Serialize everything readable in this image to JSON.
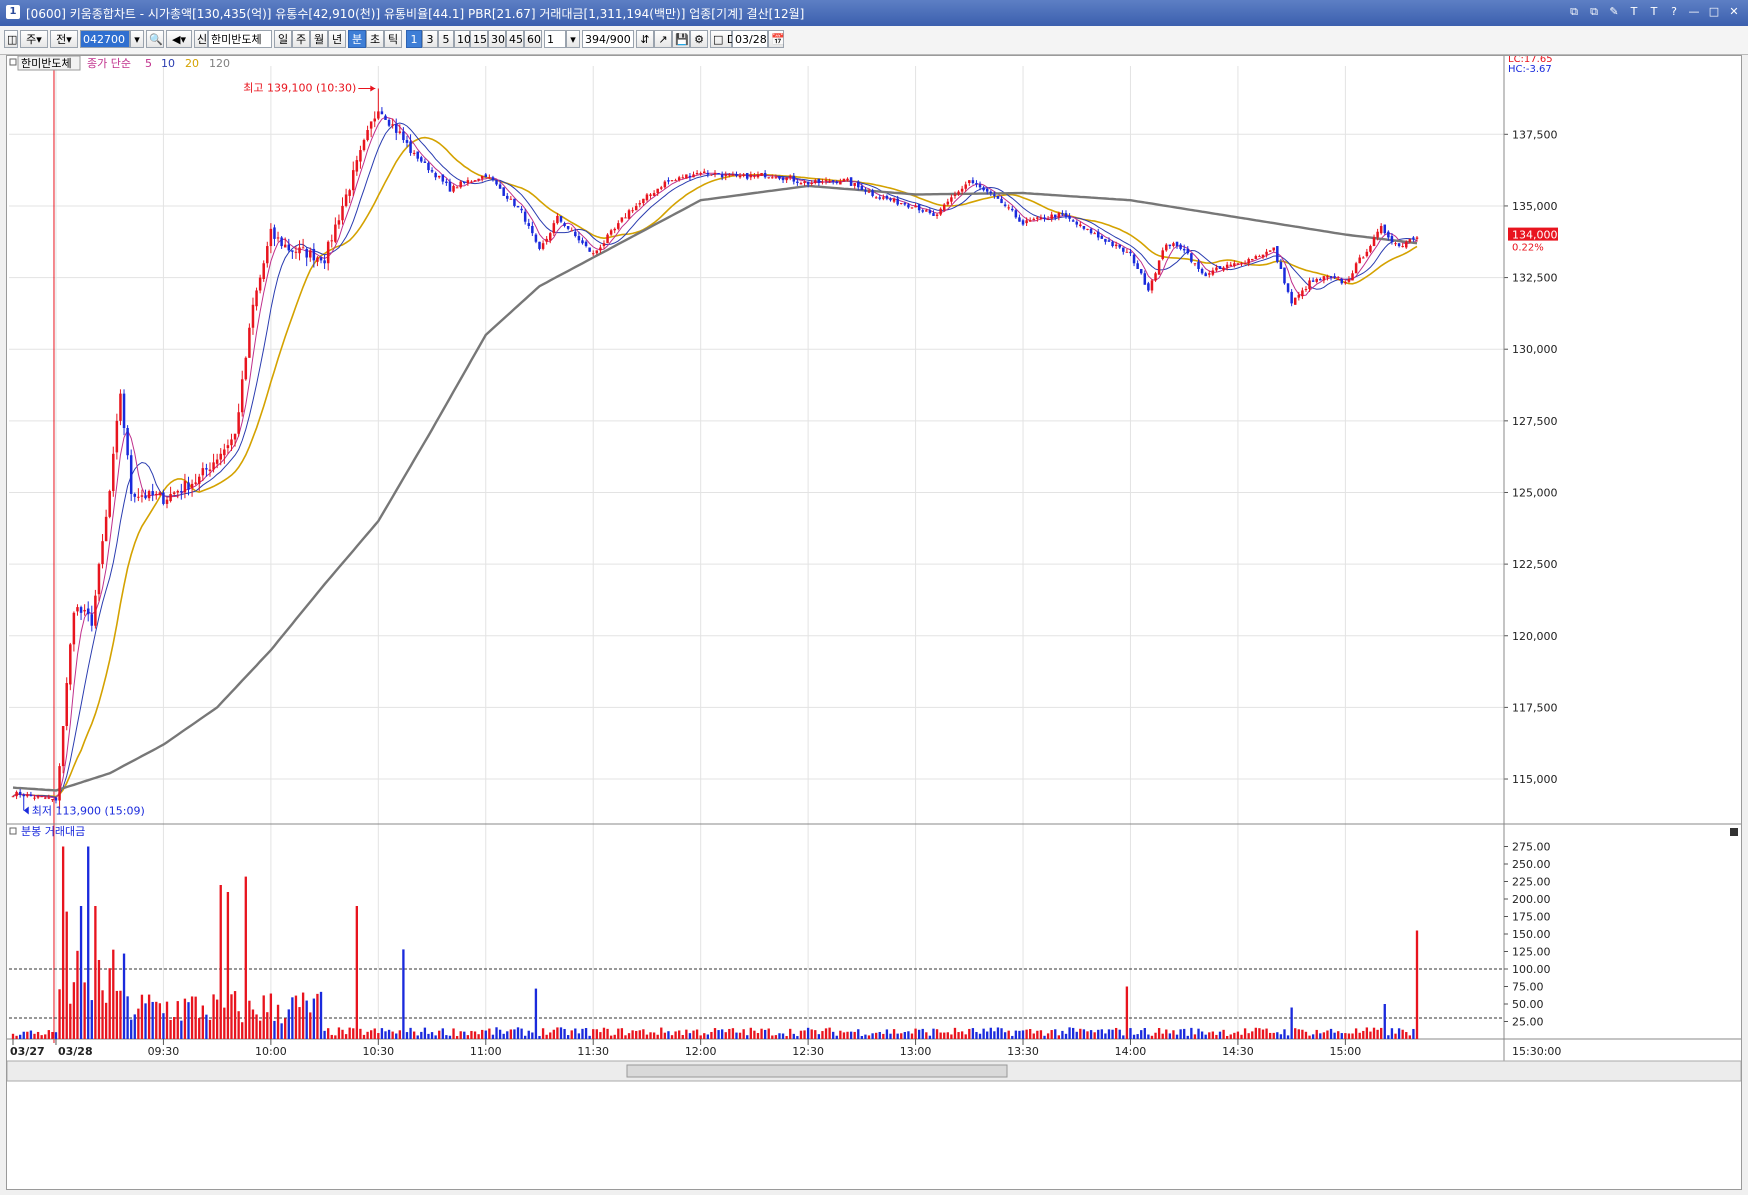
{
  "window": {
    "icon_label": "1",
    "title": "[0600] 키움종합차트 - 시가총액[130,435(억)] 유통수[42,910(천)] 유통비율[44.1] PBR[21.67] 거래대금[1,311,194(백만)] 업종[기계] 결산[12월]",
    "buttons": [
      "⧉",
      "⧉",
      "✎",
      "T",
      "T",
      "?",
      "—",
      "□",
      "✕"
    ]
  },
  "toolbar": {
    "items": [
      {
        "label": "◫",
        "name": "layout-icon"
      },
      {
        "label": "주▾",
        "name": "market-select"
      },
      {
        "label": "전▾",
        "name": "scope-select"
      },
      {
        "label": "042700",
        "name": "stock-code-input",
        "selected": true
      },
      {
        "label": "▾",
        "name": "code-dropdown"
      },
      {
        "label": "🔍",
        "name": "search-icon"
      },
      {
        "label": "◀▾",
        "name": "sound-icon"
      },
      {
        "label": "신",
        "name": "new-button"
      },
      {
        "label": "한미반도체",
        "name": "stock-name-field"
      },
      {
        "label": "일",
        "name": "period-day"
      },
      {
        "label": "주",
        "name": "period-week"
      },
      {
        "label": "월",
        "name": "period-month"
      },
      {
        "label": "년",
        "name": "period-year"
      },
      {
        "label": "분",
        "name": "period-minute",
        "on": true
      },
      {
        "label": "초",
        "name": "period-second"
      },
      {
        "label": "틱",
        "name": "period-tick"
      },
      {
        "label": "1",
        "name": "interval-1",
        "on": true
      },
      {
        "label": "3",
        "name": "interval-3"
      },
      {
        "label": "5",
        "name": "interval-5"
      },
      {
        "label": "10",
        "name": "interval-10"
      },
      {
        "label": "15",
        "name": "interval-15"
      },
      {
        "label": "30",
        "name": "interval-30"
      },
      {
        "label": "45",
        "name": "interval-45"
      },
      {
        "label": "60",
        "name": "interval-60"
      },
      {
        "label": "1",
        "name": "custom-interval-input"
      },
      {
        "label": "▾",
        "name": "custom-interval-dropdown"
      },
      {
        "label": "394/900",
        "name": "data-count-field"
      },
      {
        "label": "⇵",
        "name": "crosshair-icon"
      },
      {
        "label": "↗",
        "name": "trend-tool-icon"
      },
      {
        "label": "💾",
        "name": "save-icon"
      },
      {
        "label": "⚙",
        "name": "settings-icon"
      },
      {
        "label": "□ D",
        "name": "date-checkbox"
      },
      {
        "label": "03/28",
        "name": "date-field"
      },
      {
        "label": "📅",
        "name": "calendar-icon"
      }
    ]
  },
  "price_panel": {
    "stock_tab": "한미반도체",
    "indicator_label": "종가 단순",
    "ma_labels": [
      {
        "text": "5",
        "color": "#c0308c"
      },
      {
        "text": "10",
        "color": "#2a3cb0"
      },
      {
        "text": "20",
        "color": "#d4a200"
      },
      {
        "text": "120",
        "color": "#808080"
      }
    ],
    "lc_label": "LC:17.65",
    "hc_label": "HC:-3.67",
    "high_annotation": "최고 139,100 (10:30)",
    "low_annotation": "최저 113,900 (15:09)",
    "current_price": "134,000",
    "current_change": "0.22%",
    "y_ticks": [
      "137,500",
      "135,000",
      "132,500",
      "130,000",
      "127,500",
      "125,000",
      "122,500",
      "120,000",
      "117,500",
      "115,000"
    ]
  },
  "volume_panel": {
    "label": "분봉 거래대금",
    "y_ticks": [
      "275.00",
      "250.00",
      "225.00",
      "200.00",
      "175.00",
      "150.00",
      "125.00",
      "100.00",
      "75.00",
      "50.00",
      "25.00"
    ]
  },
  "x_axis": {
    "labels": [
      "03/27",
      "03/28",
      "09:30",
      "10:00",
      "10:30",
      "11:00",
      "11:30",
      "12:00",
      "12:30",
      "13:00",
      "13:30",
      "14:00",
      "14:30",
      "15:00"
    ],
    "time_readout": "15:30:00"
  },
  "colors": {
    "up": "#e8141e",
    "down": "#1a2adc",
    "ma5": "#c0308c",
    "ma10": "#2a3cb0",
    "ma20": "#d4a200",
    "ma120": "#777777"
  },
  "chart_data": {
    "type": "candlestick",
    "symbol": "한미반도체",
    "interval": "1 minute",
    "ylim": [
      113500,
      139500
    ],
    "price_anchors": [
      {
        "t": "03/27 15:19",
        "close": 114500
      },
      {
        "t": "03/27 15:30",
        "close": 114300
      },
      {
        "t": "09:00",
        "close": 114200
      },
      {
        "t": "09:05",
        "close": 121000
      },
      {
        "t": "09:10",
        "close": 120500
      },
      {
        "t": "09:15",
        "close": 125000
      },
      {
        "t": "09:18",
        "close": 128500
      },
      {
        "t": "09:21",
        "close": 125000
      },
      {
        "t": "09:30",
        "close": 124800
      },
      {
        "t": "09:40",
        "close": 125500
      },
      {
        "t": "09:50",
        "close": 127000
      },
      {
        "t": "09:55",
        "close": 131500
      },
      {
        "t": "10:00",
        "close": 134000
      },
      {
        "t": "10:05",
        "close": 133500
      },
      {
        "t": "10:15",
        "close": 133200
      },
      {
        "t": "10:25",
        "close": 136800
      },
      {
        "t": "10:30",
        "close": 138500
      },
      {
        "t": "10:40",
        "close": 136800
      },
      {
        "t": "10:50",
        "close": 135600
      },
      {
        "t": "11:00",
        "close": 136100
      },
      {
        "t": "11:10",
        "close": 134800
      },
      {
        "t": "11:15",
        "close": 133400
      },
      {
        "t": "11:20",
        "close": 134600
      },
      {
        "t": "11:30",
        "close": 133300
      },
      {
        "t": "11:40",
        "close": 134800
      },
      {
        "t": "11:50",
        "close": 135800
      },
      {
        "t": "12:00",
        "close": 136200
      },
      {
        "t": "12:10",
        "close": 136000
      },
      {
        "t": "12:20",
        "close": 136100
      },
      {
        "t": "12:30",
        "close": 135800
      },
      {
        "t": "12:40",
        "close": 135900
      },
      {
        "t": "12:50",
        "close": 135300
      },
      {
        "t": "13:00",
        "close": 135000
      },
      {
        "t": "13:05",
        "close": 134600
      },
      {
        "t": "13:15",
        "close": 135900
      },
      {
        "t": "13:25",
        "close": 135000
      },
      {
        "t": "13:30",
        "close": 134400
      },
      {
        "t": "13:40",
        "close": 134700
      },
      {
        "t": "13:50",
        "close": 134000
      },
      {
        "t": "14:00",
        "close": 133300
      },
      {
        "t": "14:05",
        "close": 132100
      },
      {
        "t": "14:10",
        "close": 133700
      },
      {
        "t": "14:15",
        "close": 133500
      },
      {
        "t": "14:20",
        "close": 132600
      },
      {
        "t": "14:30",
        "close": 133000
      },
      {
        "t": "14:40",
        "close": 133500
      },
      {
        "t": "14:45",
        "close": 131600
      },
      {
        "t": "14:50",
        "close": 132300
      },
      {
        "t": "14:55",
        "close": 132500
      },
      {
        "t": "15:00",
        "close": 132300
      },
      {
        "t": "15:05",
        "close": 133300
      },
      {
        "t": "15:10",
        "close": 134200
      },
      {
        "t": "15:15",
        "close": 133600
      },
      {
        "t": "15:20",
        "close": 134000
      }
    ],
    "ma120_anchors": [
      {
        "t": "03/27 15:19",
        "value": 114700
      },
      {
        "t": "09:00",
        "value": 114600
      },
      {
        "t": "09:15",
        "value": 115200
      },
      {
        "t": "09:30",
        "value": 116200
      },
      {
        "t": "09:45",
        "value": 117500
      },
      {
        "t": "10:00",
        "value": 119500
      },
      {
        "t": "10:15",
        "value": 121800
      },
      {
        "t": "10:30",
        "value": 124000
      },
      {
        "t": "10:45",
        "value": 127200
      },
      {
        "t": "11:00",
        "value": 130500
      },
      {
        "t": "11:15",
        "value": 132200
      },
      {
        "t": "11:30",
        "value": 133200
      },
      {
        "t": "11:45",
        "value": 134200
      },
      {
        "t": "12:00",
        "value": 135200
      },
      {
        "t": "12:30",
        "value": 135700
      },
      {
        "t": "13:00",
        "value": 135400
      },
      {
        "t": "13:30",
        "value": 135450
      },
      {
        "t": "14:00",
        "value": 135200
      },
      {
        "t": "14:30",
        "value": 134600
      },
      {
        "t": "15:00",
        "value": 134000
      },
      {
        "t": "15:20",
        "value": 133700
      }
    ],
    "high": {
      "value": 139100,
      "time": "10:30"
    },
    "low": {
      "value": 113900,
      "time": "15:09"
    },
    "volume_peaks": [
      {
        "t": "09:02",
        "value": 275
      },
      {
        "t": "09:03",
        "value": 182
      },
      {
        "t": "09:07",
        "value": 190
      },
      {
        "t": "09:09",
        "value": 275
      },
      {
        "t": "09:11",
        "value": 190
      },
      {
        "t": "09:46",
        "value": 220
      },
      {
        "t": "09:48",
        "value": 210
      },
      {
        "t": "09:53",
        "value": 232
      },
      {
        "t": "10:24",
        "value": 190
      },
      {
        "t": "10:37",
        "value": 128
      },
      {
        "t": "11:14",
        "value": 72
      },
      {
        "t": "13:59",
        "value": 75
      },
      {
        "t": "14:45",
        "value": 45
      },
      {
        "t": "15:11",
        "value": 50
      },
      {
        "t": "15:20",
        "value": 155
      }
    ],
    "volume_reference_lines": [
      100,
      30
    ]
  }
}
